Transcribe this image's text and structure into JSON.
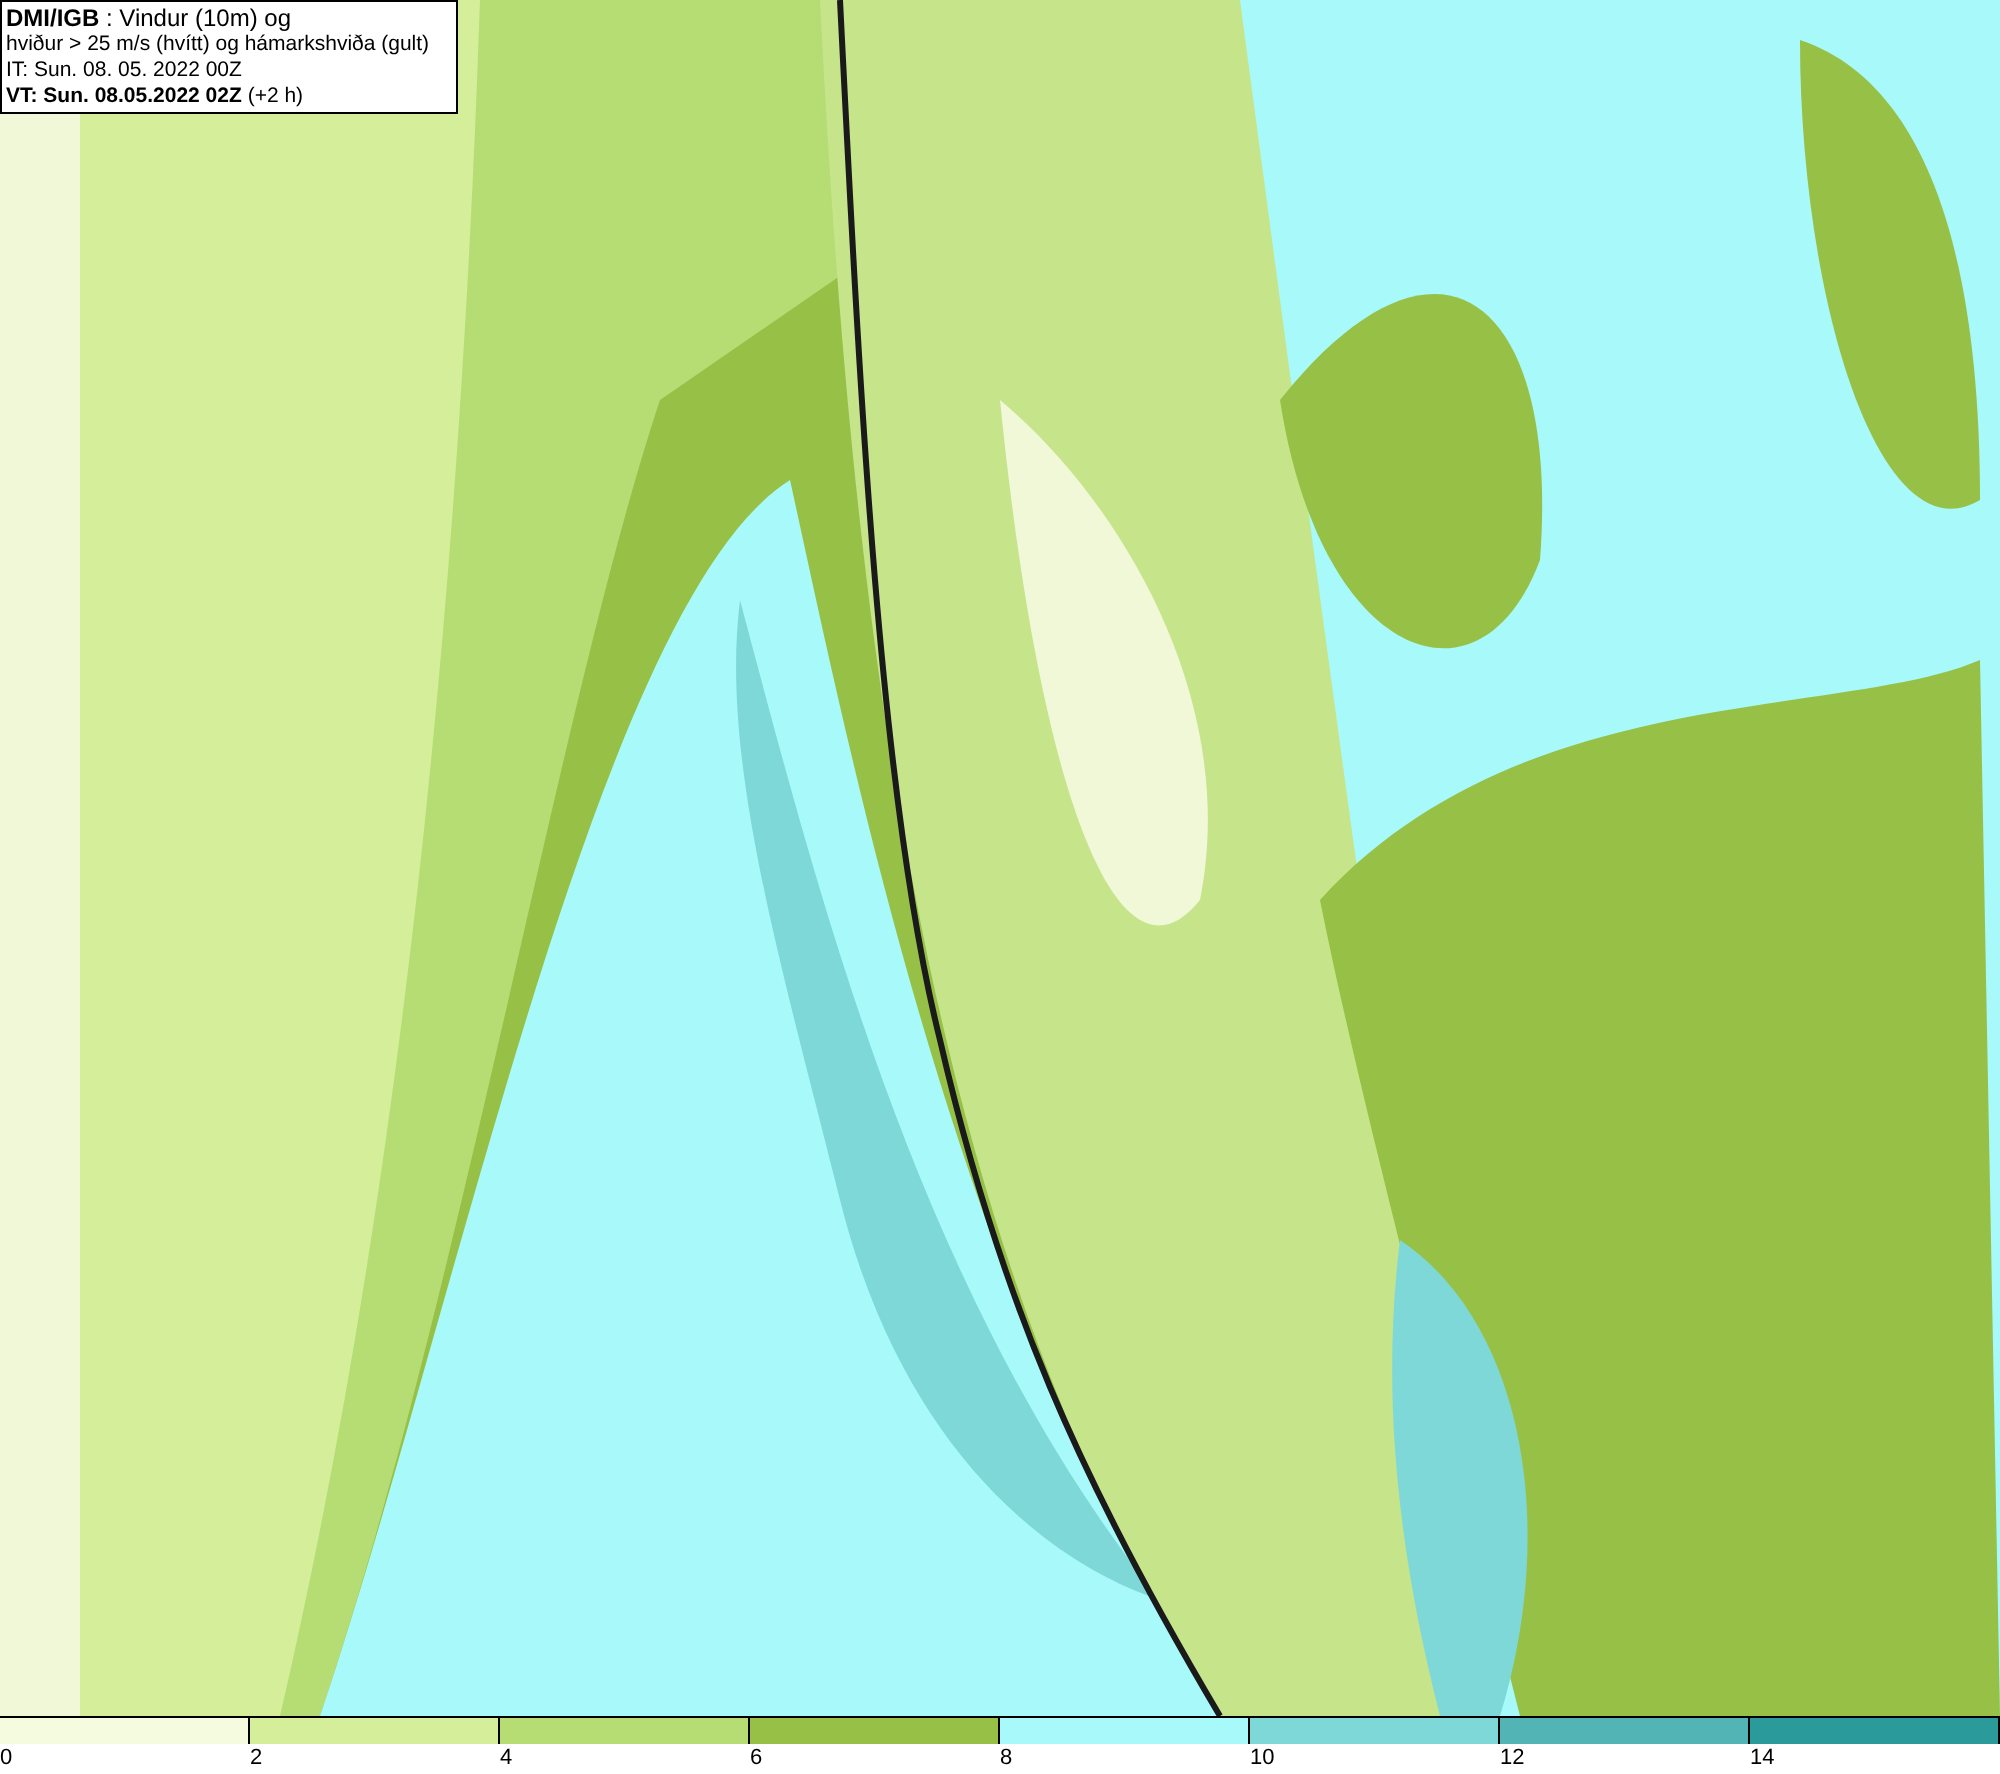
{
  "header": {
    "lines": [
      "**DMI/IGB** : Vindur (10m) og",
      "hviður > 25 m/s (hvítt) og hámarkshviða (gult)",
      "IT: Sun. 08. 05. 2022 00Z",
      "**VT: Sun. 08.05.2022 02Z** (+2 h)"
    ]
  },
  "legend": {
    "bins": [
      {
        "label": "0",
        "color": "#f5fbdf"
      },
      {
        "label": "2",
        "color": "#d4ee9a"
      },
      {
        "label": "4",
        "color": "#b6dc74"
      },
      {
        "label": "6",
        "color": "#97c047"
      },
      {
        "label": "8",
        "color": "#a8fafa"
      },
      {
        "label": "10",
        "color": "#7fd8d8"
      },
      {
        "label": "12",
        "color": "#52b4b4"
      },
      {
        "label": "14",
        "color": "#2a9a9a"
      }
    ]
  }
}
